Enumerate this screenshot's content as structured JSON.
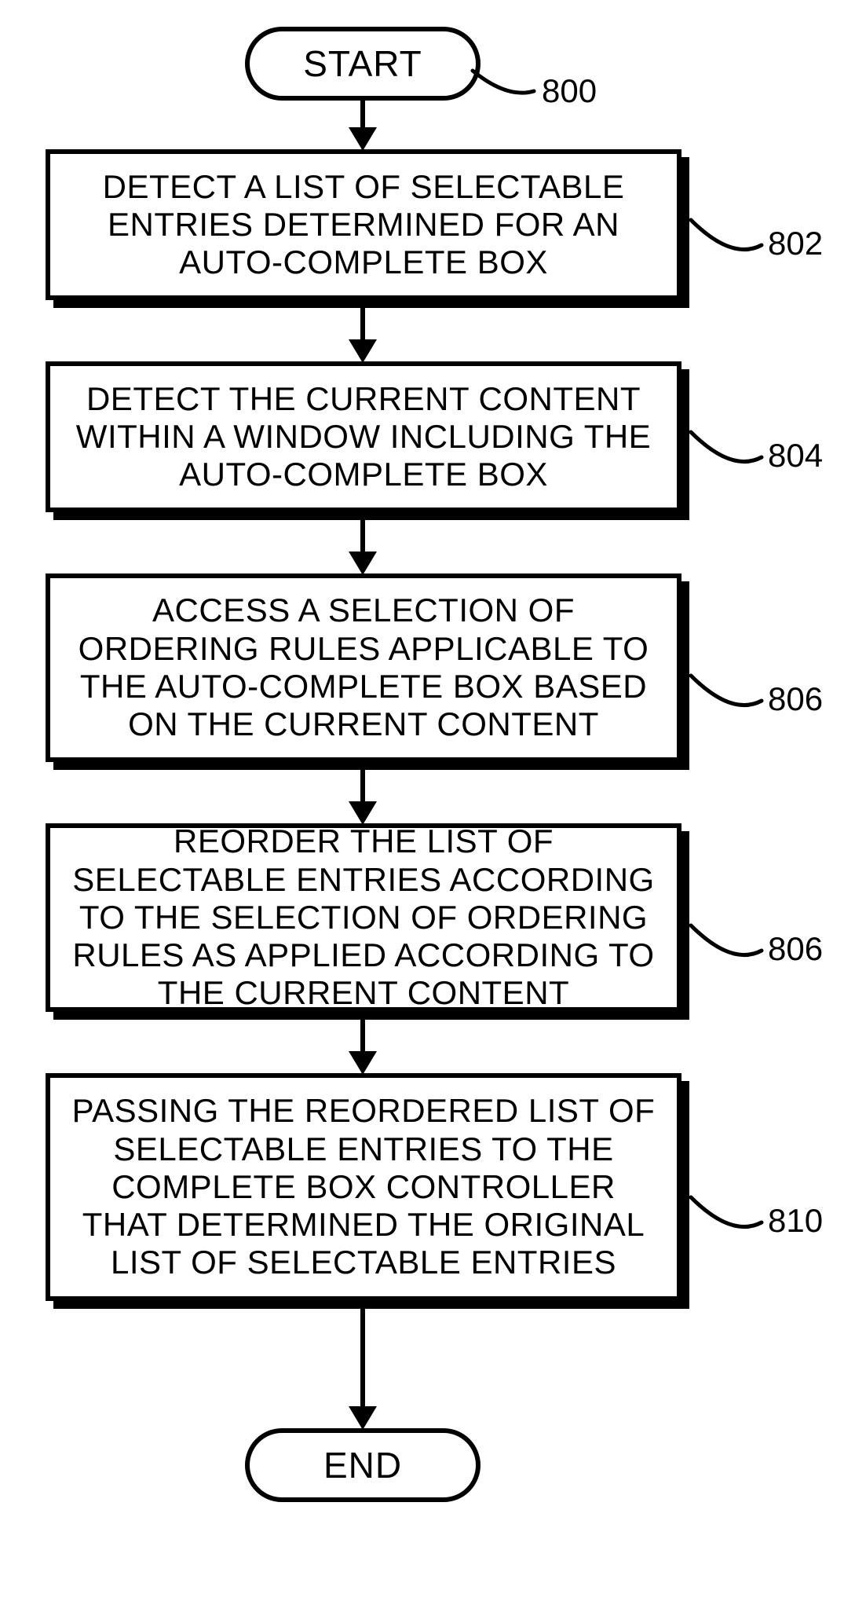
{
  "chart_data": {
    "type": "flowchart",
    "nodes": [
      {
        "id": "start",
        "shape": "terminator",
        "label": "START",
        "ref": "800"
      },
      {
        "id": "s1",
        "shape": "process",
        "label": "DETECT A LIST OF SELECTABLE ENTRIES DETERMINED FOR AN AUTO-COMPLETE BOX",
        "ref": "802"
      },
      {
        "id": "s2",
        "shape": "process",
        "label": "DETECT THE CURRENT CONTENT WITHIN A WINDOW INCLUDING THE AUTO-COMPLETE BOX",
        "ref": "804"
      },
      {
        "id": "s3",
        "shape": "process",
        "label": "ACCESS A SELECTION OF ORDERING RULES APPLICABLE TO THE AUTO-COMPLETE BOX BASED ON THE CURRENT CONTENT",
        "ref": "806"
      },
      {
        "id": "s4",
        "shape": "process",
        "label": "REORDER THE LIST OF SELECTABLE ENTRIES ACCORDING TO THE SELECTION OF ORDERING RULES AS APPLIED ACCORDING TO THE CURRENT CONTENT",
        "ref": "806"
      },
      {
        "id": "s5",
        "shape": "process",
        "label": "PASSING THE REORDERED LIST OF SELECTABLE ENTRIES TO THE COMPLETE BOX CONTROLLER THAT DETERMINED THE ORIGINAL LIST OF SELECTABLE ENTRIES",
        "ref": "810"
      },
      {
        "id": "end",
        "shape": "terminator",
        "label": "END",
        "ref": null
      }
    ],
    "edges": [
      [
        "start",
        "s1"
      ],
      [
        "s1",
        "s2"
      ],
      [
        "s2",
        "s3"
      ],
      [
        "s3",
        "s4"
      ],
      [
        "s4",
        "s5"
      ],
      [
        "s5",
        "end"
      ]
    ]
  },
  "terminators": {
    "start": {
      "label": "START"
    },
    "end": {
      "label": "END"
    }
  },
  "steps": {
    "s1": {
      "label": "DETECT A LIST OF SELECTABLE ENTRIES DETERMINED FOR AN AUTO-COMPLETE BOX"
    },
    "s2": {
      "label": "DETECT THE CURRENT CONTENT WITHIN A WINDOW INCLUDING THE AUTO-COMPLETE BOX"
    },
    "s3": {
      "label": "ACCESS A SELECTION OF ORDERING RULES APPLICABLE TO THE AUTO-COMPLETE BOX BASED ON THE CURRENT CONTENT"
    },
    "s4": {
      "label": "REORDER THE LIST OF SELECTABLE ENTRIES ACCORDING TO THE SELECTION OF ORDERING RULES AS APPLIED ACCORDING TO THE CURRENT CONTENT"
    },
    "s5": {
      "label": "PASSING THE REORDERED LIST OF SELECTABLE ENTRIES TO THE COMPLETE BOX CONTROLLER THAT DETERMINED THE ORIGINAL LIST OF SELECTABLE ENTRIES"
    }
  },
  "refs": {
    "r800": "800",
    "r802": "802",
    "r804": "804",
    "r806a": "806",
    "r806b": "806",
    "r810": "810"
  }
}
